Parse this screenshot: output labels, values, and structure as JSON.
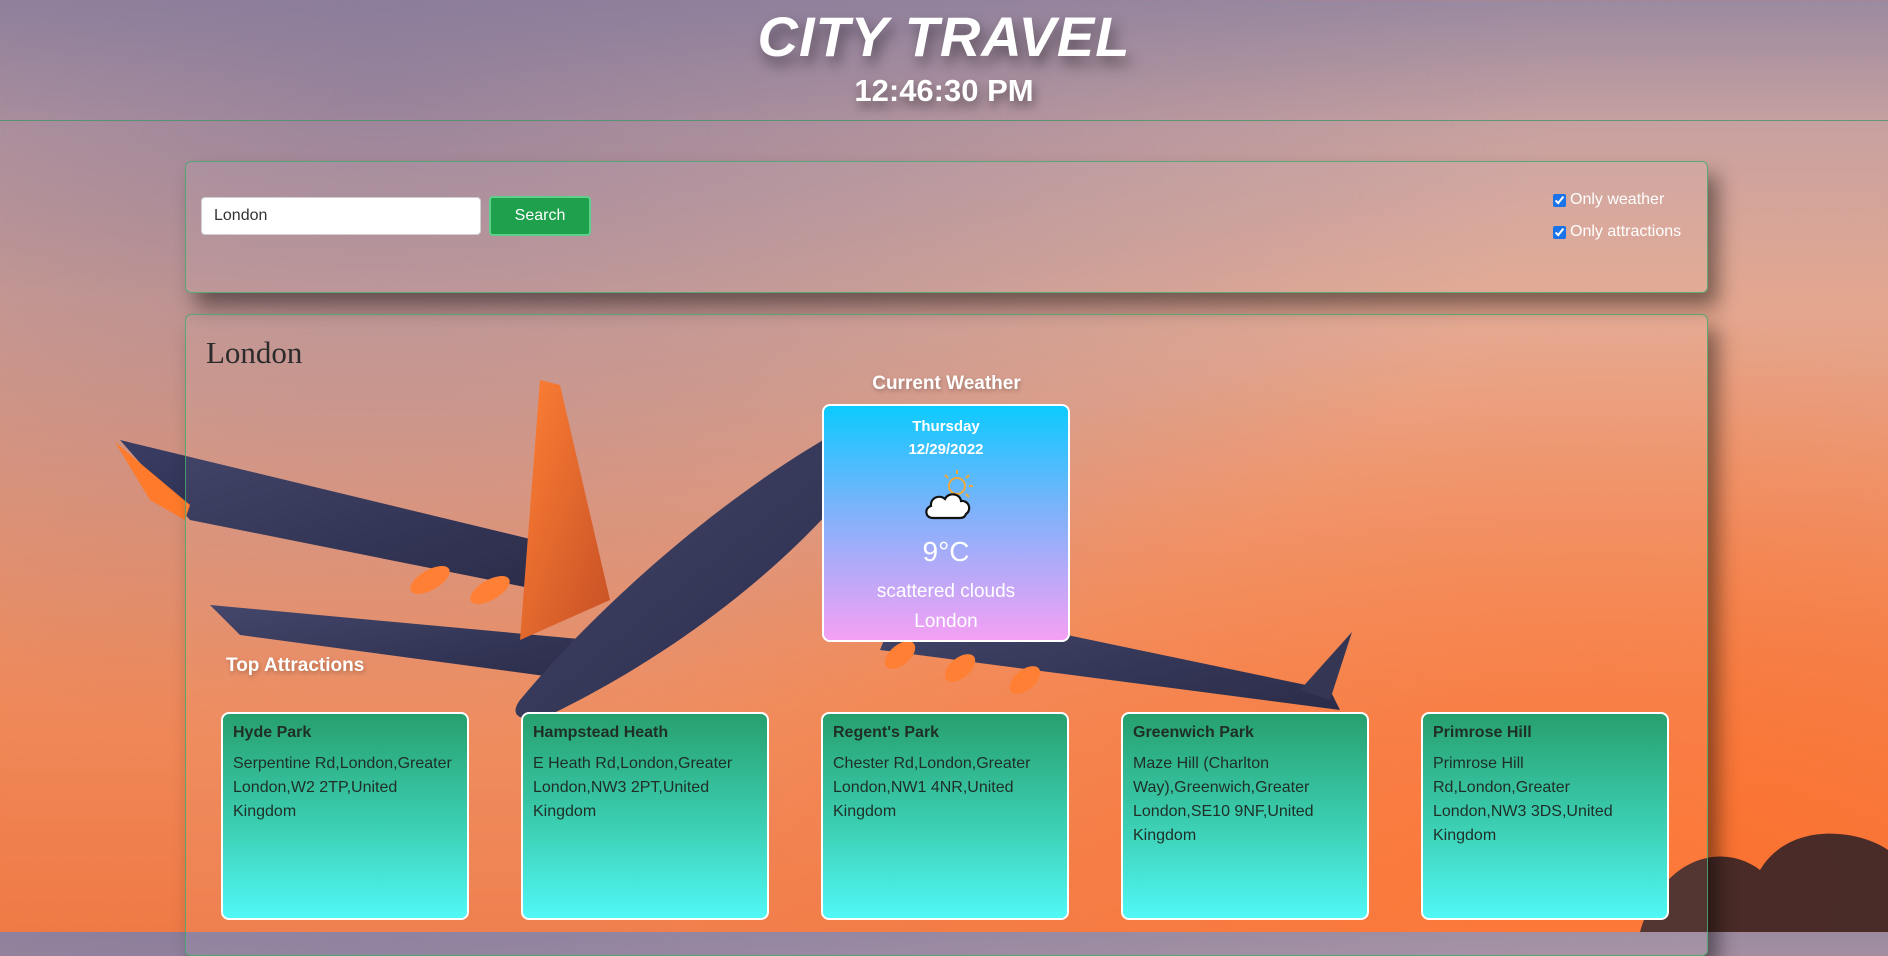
{
  "header": {
    "title": "CITY TRAVEL",
    "clock": "12:46:30 PM"
  },
  "search": {
    "value": "London",
    "button_label": "Search"
  },
  "options": [
    {
      "label": "Only weather",
      "checked": true
    },
    {
      "label": "Only attractions",
      "checked": true
    }
  ],
  "results": {
    "city": "London",
    "weather_heading": "Current Weather",
    "attractions_heading": "Top Attractions"
  },
  "weather": {
    "day": "Thursday",
    "date": "12/29/2022",
    "icon": "partly-cloudy-icon",
    "temp": "9°C",
    "description": "scattered clouds",
    "city": "London"
  },
  "attractions": [
    {
      "name": "Hyde Park",
      "address": "Serpentine Rd,London,Greater London,W2 2TP,United Kingdom"
    },
    {
      "name": "Hampstead Heath",
      "address": "E Heath Rd,London,Greater London,NW3 2PT,United Kingdom"
    },
    {
      "name": "Regent's Park",
      "address": "Chester Rd,London,Greater London,NW1 4NR,United Kingdom"
    },
    {
      "name": "Greenwich Park",
      "address": "Maze Hill (Charlton Way),Greenwich,Greater London,SE10 9NF,United Kingdom"
    },
    {
      "name": "Primrose Hill",
      "address": "Primrose Hill Rd,London,Greater London,NW3 3DS,United Kingdom"
    }
  ],
  "colors": {
    "search_button": "#1ea04c",
    "panel_border": "#46aa6e",
    "weather_card_top": "#0ccaff",
    "weather_card_bottom": "#f5a0f4",
    "attraction_card_top": "#27a06d",
    "attraction_card_bottom": "#50f8f6"
  }
}
